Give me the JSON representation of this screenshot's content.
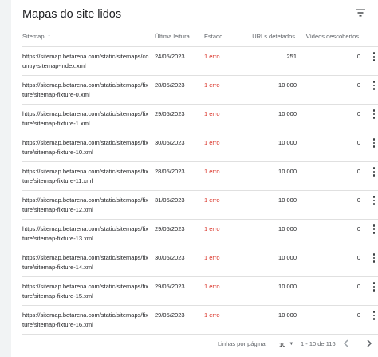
{
  "title": "Mapas do site lidos",
  "columns": {
    "sitemap": "Sitemap",
    "last_read": "Última leitura",
    "status": "Estado",
    "urls_detected": "URLs detetados",
    "videos_found": "Vídeos descobertos"
  },
  "rows": [
    {
      "url": "https://sitemap.betarena.com/static/sitemaps/country-sitemap-index.xml",
      "date": "24/05/2023",
      "status": "1 erro",
      "urls": "251",
      "videos": "0"
    },
    {
      "url": "https://sitemap.betarena.com/static/sitemaps/fixture/sitemap-fixture-0.xml",
      "date": "28/05/2023",
      "status": "1 erro",
      "urls": "10 000",
      "videos": "0"
    },
    {
      "url": "https://sitemap.betarena.com/static/sitemaps/fixture/sitemap-fixture-1.xml",
      "date": "29/05/2023",
      "status": "1 erro",
      "urls": "10 000",
      "videos": "0"
    },
    {
      "url": "https://sitemap.betarena.com/static/sitemaps/fixture/sitemap-fixture-10.xml",
      "date": "30/05/2023",
      "status": "1 erro",
      "urls": "10 000",
      "videos": "0"
    },
    {
      "url": "https://sitemap.betarena.com/static/sitemaps/fixture/sitemap-fixture-11.xml",
      "date": "28/05/2023",
      "status": "1 erro",
      "urls": "10 000",
      "videos": "0"
    },
    {
      "url": "https://sitemap.betarena.com/static/sitemaps/fixture/sitemap-fixture-12.xml",
      "date": "31/05/2023",
      "status": "1 erro",
      "urls": "10 000",
      "videos": "0"
    },
    {
      "url": "https://sitemap.betarena.com/static/sitemaps/fixture/sitemap-fixture-13.xml",
      "date": "29/05/2023",
      "status": "1 erro",
      "urls": "10 000",
      "videos": "0"
    },
    {
      "url": "https://sitemap.betarena.com/static/sitemaps/fixture/sitemap-fixture-14.xml",
      "date": "30/05/2023",
      "status": "1 erro",
      "urls": "10 000",
      "videos": "0"
    },
    {
      "url": "https://sitemap.betarena.com/static/sitemaps/fixture/sitemap-fixture-15.xml",
      "date": "29/05/2023",
      "status": "1 erro",
      "urls": "10 000",
      "videos": "0"
    },
    {
      "url": "https://sitemap.betarena.com/static/sitemaps/fixture/sitemap-fixture-16.xml",
      "date": "29/05/2023",
      "status": "1 erro",
      "urls": "10 000",
      "videos": "0"
    }
  ],
  "footer": {
    "rows_per_page_label": "Linhas por página:",
    "rows_per_page_value": "10",
    "range": "1 - 10 de 116"
  },
  "icons": {
    "filter": "filter-icon",
    "sort": "arrow-up-icon",
    "row_menu": "more-vert-icon",
    "dropdown": "caret-down-icon",
    "prev": "chevron-left-icon",
    "next": "chevron-right-icon"
  },
  "colors": {
    "error": "#d93025",
    "header_text": "#5f6368",
    "divider": "#e0e0e0"
  }
}
